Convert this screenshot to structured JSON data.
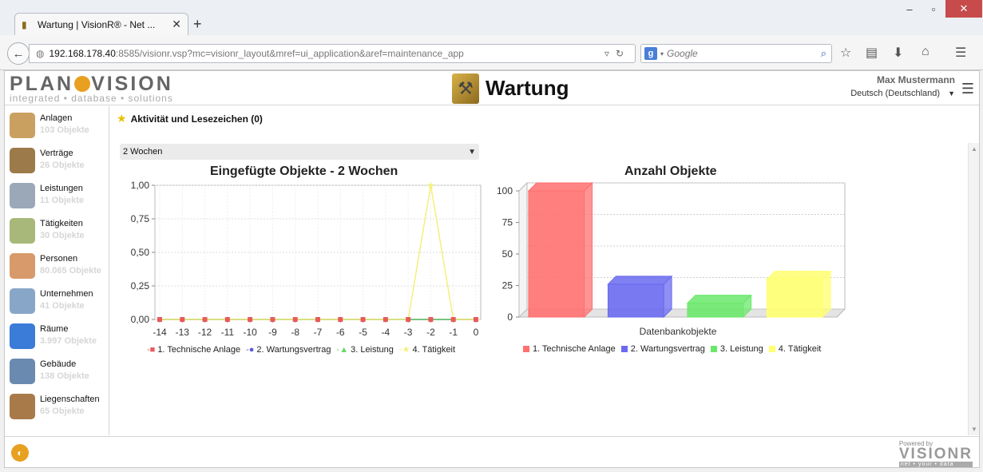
{
  "browser": {
    "tab_title": "Wartung | VisionR® - Net ...",
    "url_host": "192.168.178.40",
    "url_path": ":8585/visionr.vsp?mc=visionr_layout&mref=ui_application&aref=maintenance_app",
    "search_placeholder": "Google",
    "search_engine_badge": "g"
  },
  "header": {
    "logo_text_a": "PLAN",
    "logo_text_b": "VISION",
    "logo_tagline": "integrated • database • solutions",
    "title": "Wartung",
    "user_name": "Max Mustermann",
    "language": "Deutsch (Deutschland)"
  },
  "sidebar": {
    "items": [
      {
        "label": "Anlagen",
        "count": "103 Objekte",
        "icon": "toolbox-icon",
        "color": "#c9a060"
      },
      {
        "label": "Verträge",
        "count": "26 Objekte",
        "icon": "contract-icon",
        "color": "#9c7a4a"
      },
      {
        "label": "Leistungen",
        "count": "11 Objekte",
        "icon": "meter-icon",
        "color": "#9aa8b8"
      },
      {
        "label": "Tätigkeiten",
        "count": "30 Objekte",
        "icon": "checklist-icon",
        "color": "#a8b87a"
      },
      {
        "label": "Personen",
        "count": "80.065 Objekte",
        "icon": "person-icon",
        "color": "#d89a6a"
      },
      {
        "label": "Unternehmen",
        "count": "41 Objekte",
        "icon": "group-icon",
        "color": "#88a6c8"
      },
      {
        "label": "Räume",
        "count": "3.997 Objekte",
        "icon": "room-icon",
        "color": "#3a7cd8"
      },
      {
        "label": "Gebäude",
        "count": "138 Objekte",
        "icon": "building-icon",
        "color": "#6a8ab0"
      },
      {
        "label": "Liegenschaften",
        "count": "65 Objekte",
        "icon": "house-icon",
        "color": "#a87a4a"
      }
    ]
  },
  "main": {
    "bookmarks_title": "Aktivität und Lesezeichen (0)",
    "period": "2 Wochen"
  },
  "chart_data": [
    {
      "type": "line",
      "title": "Eingefügte Objekte - 2 Wochen",
      "x": [
        -14,
        -13,
        -12,
        -11,
        -10,
        -9,
        -8,
        -7,
        -6,
        -5,
        -4,
        -3,
        -2,
        -1,
        0
      ],
      "ylim": [
        0,
        1
      ],
      "yticks": [
        "0,00",
        "0,25",
        "0,50",
        "0,75",
        "1,00"
      ],
      "grid": true,
      "legend_position": "bottom",
      "series": [
        {
          "name": "1. Technische Anlage",
          "color": "#e85a5a",
          "marker": "square",
          "values": [
            0,
            0,
            0,
            0,
            0,
            0,
            0,
            0,
            0,
            0,
            0,
            0,
            0,
            0,
            0
          ]
        },
        {
          "name": "2. Wartungsvertrag",
          "color": "#5a5ad8",
          "marker": "circle",
          "values": [
            0,
            0,
            0,
            0,
            0,
            0,
            0,
            0,
            0,
            0,
            0,
            0,
            0,
            0,
            0
          ]
        },
        {
          "name": "3. Leistung",
          "color": "#6ad86a",
          "marker": "triangle",
          "values": [
            0,
            0,
            0,
            0,
            0,
            0,
            0,
            0,
            0,
            0,
            0,
            0,
            0,
            0,
            0
          ]
        },
        {
          "name": "4. Tätigkeit",
          "color": "#f4f07a",
          "marker": "star",
          "values": [
            0,
            0,
            0,
            0,
            0,
            0,
            0,
            0,
            0,
            0,
            0,
            0,
            1,
            0,
            0
          ]
        }
      ]
    },
    {
      "type": "bar",
      "title": "Anzahl Objekte",
      "xlabel": "Datenbankobjekte",
      "ylim": [
        0,
        100
      ],
      "yticks": [
        "0",
        "25",
        "50",
        "75",
        "100"
      ],
      "legend_position": "bottom",
      "categories": [
        "1. Technische Anlage",
        "2. Wartungsvertrag",
        "3. Leistung",
        "4. Tätigkeit"
      ],
      "values": [
        103,
        26,
        11,
        30
      ],
      "colors": [
        "#ff7070",
        "#6a6af0",
        "#6ae86a",
        "#ffff70"
      ]
    }
  ],
  "footer": {
    "powered_by": "Powered by",
    "brand": "VISIONR",
    "tagline": "net • your • data"
  }
}
